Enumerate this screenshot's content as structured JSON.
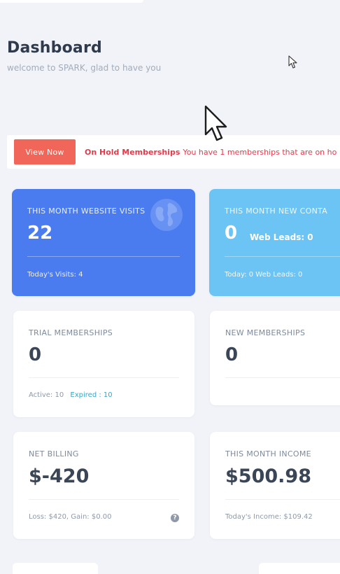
{
  "header": {
    "title": "Dashboard",
    "subtitle": "welcome to SPARK, glad to have you"
  },
  "alert": {
    "button_label": "View Now",
    "title": "On Hold Memberships",
    "message": "You have 1 memberships that are on ho"
  },
  "cards": {
    "website_visits": {
      "label": "THIS MONTH WEBSITE VISITS",
      "value": "22",
      "footer": "Today's Visits: 4"
    },
    "new_contacts": {
      "label": "THIS MONTH NEW CONTA",
      "value": "0",
      "web_leads": "Web Leads: 0",
      "footer": "Today: 0  Web Leads: 0"
    },
    "trial_memberships": {
      "label": "TRIAL MEMBERSHIPS",
      "value": "0",
      "footer_active": "Active: 10",
      "footer_expired": "Expired : 10"
    },
    "new_memberships": {
      "label": "NEW MEMBERSHIPS",
      "value": "0"
    },
    "net_billing": {
      "label": "NET BILLING",
      "value": "$-420",
      "footer": "Loss: $420, Gain: $0.00",
      "help_glyph": "?"
    },
    "month_income": {
      "label": "THIS MONTH INCOME",
      "value": "$500.98",
      "footer": "Today's Income: $109.42"
    }
  },
  "icons": {
    "visits_card": "globe-icon",
    "net_billing_card": "help-circle-icon",
    "cursor": "mouse-pointer-icon"
  },
  "colors": {
    "page_background": "#f1f3f8",
    "visits_card": "#4a7cf0",
    "contacts_card": "#6cc4f5",
    "alert_button": "#f0675a",
    "alert_text": "#e5394a"
  }
}
